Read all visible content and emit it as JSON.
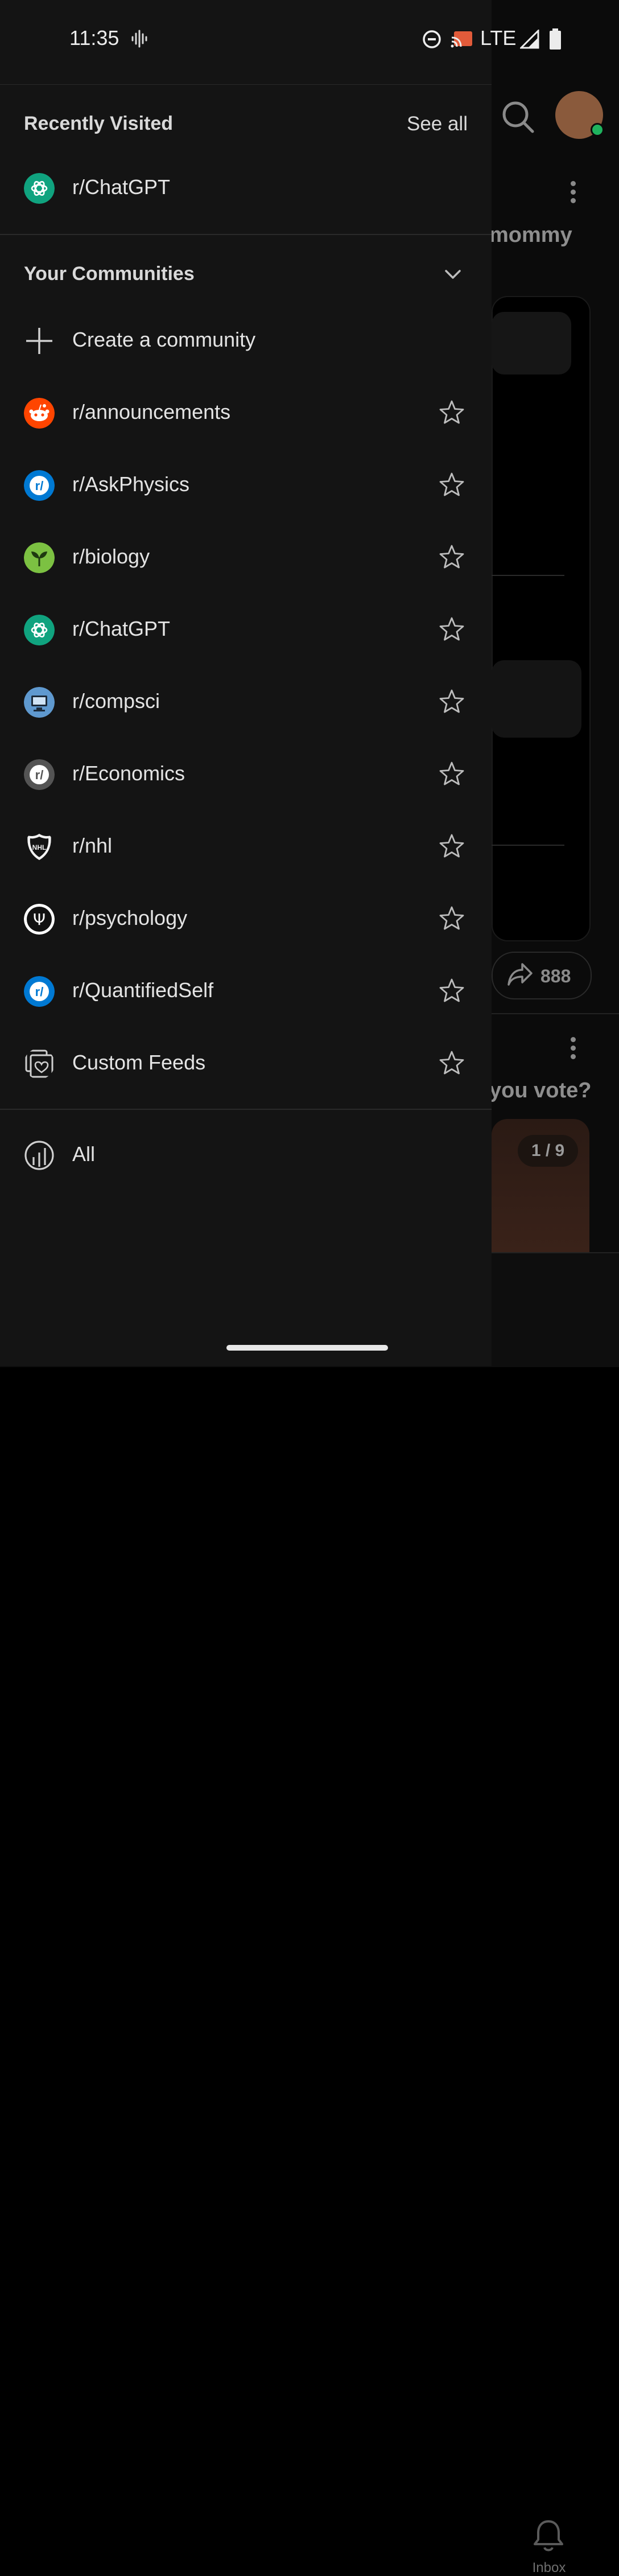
{
  "status_bar": {
    "time": "11:35",
    "network": "LTE"
  },
  "background": {
    "post1_title_fragment": "mommy",
    "share_count": "888",
    "post2_title_fragment": "you vote?",
    "image_pager": "1 / 9",
    "nav_inbox_label": "Inbox"
  },
  "recently_visited": {
    "title": "Recently Visited",
    "see_all": "See all",
    "items": [
      {
        "label": "r/ChatGPT",
        "icon": "openai-icon"
      }
    ]
  },
  "communities": {
    "title": "Your Communities",
    "create_label": "Create a community",
    "items": [
      {
        "label": "r/announcements",
        "icon": "reddit-snoo-icon",
        "color": "#ff4500"
      },
      {
        "label": "r/AskPhysics",
        "icon": "subreddit-default-icon",
        "color": "#0079d3"
      },
      {
        "label": "r/biology",
        "icon": "sprout-icon",
        "color": "#7cc142"
      },
      {
        "label": "r/ChatGPT",
        "icon": "openai-icon",
        "color": "#10a37f"
      },
      {
        "label": "r/compsci",
        "icon": "computer-icon",
        "color": "#5f99cf"
      },
      {
        "label": "r/Economics",
        "icon": "subreddit-default-icon",
        "color": "#545454"
      },
      {
        "label": "r/nhl",
        "icon": "nhl-shield-icon",
        "color": "#000000"
      },
      {
        "label": "r/psychology",
        "icon": "psi-icon",
        "color": "#ffffff"
      },
      {
        "label": "r/QuantifiedSelf",
        "icon": "subreddit-default-icon",
        "color": "#0079d3"
      },
      {
        "label": "Custom Feeds",
        "icon": "custom-feeds-icon"
      }
    ]
  },
  "all": {
    "label": "All",
    "icon": "bar-chart-circle-icon"
  }
}
